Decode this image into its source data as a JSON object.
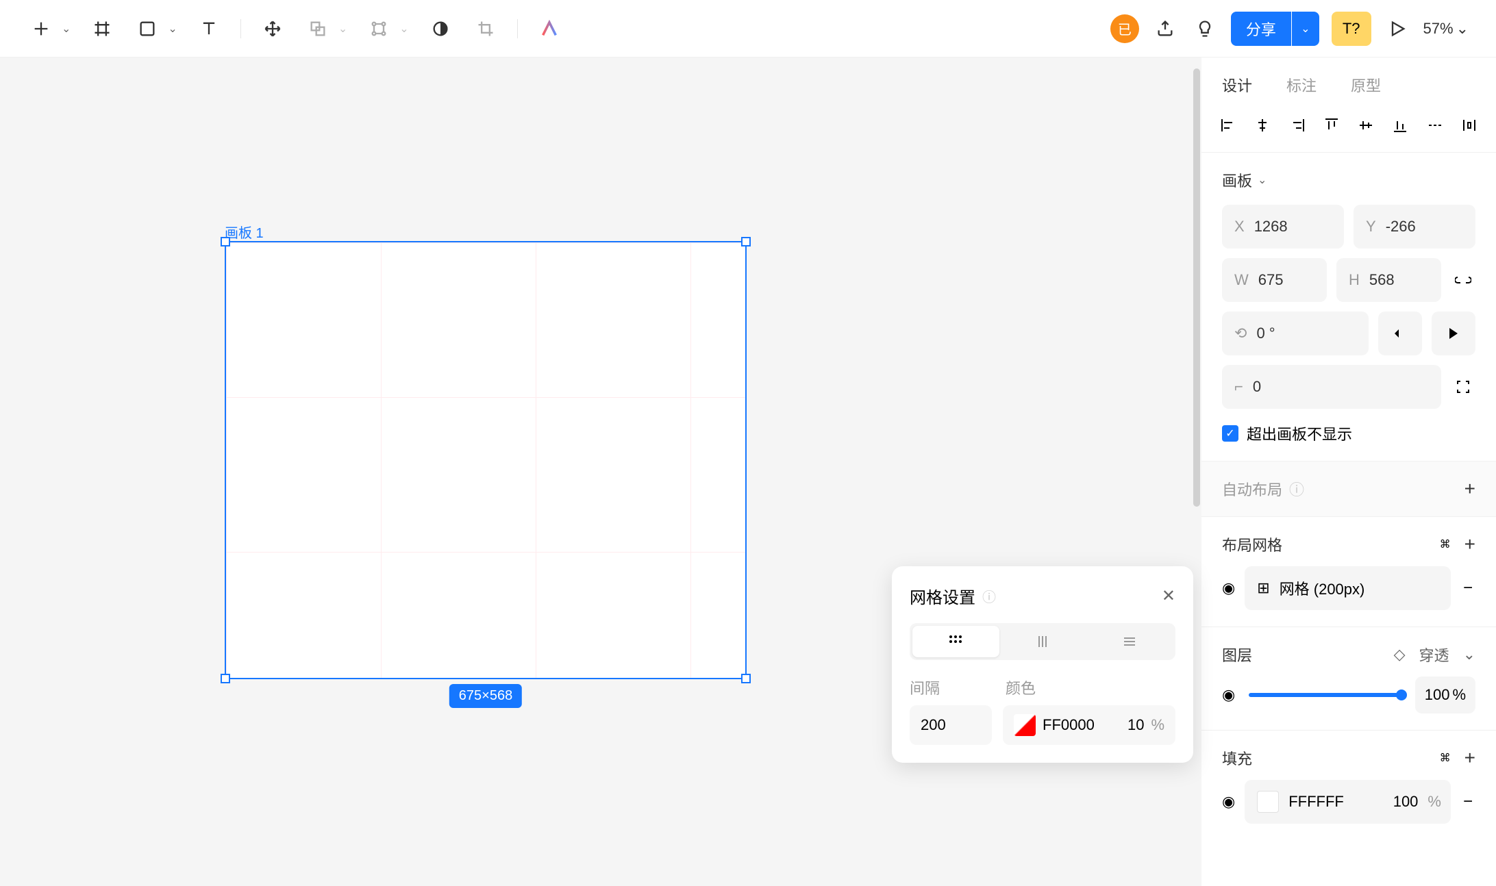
{
  "toolbar": {
    "share_label": "分享",
    "tq_label": "T?",
    "zoom": "57%",
    "saved_badge": "已"
  },
  "canvas": {
    "artboard_name": "画板 1",
    "dimensions": "675×568"
  },
  "tabs": {
    "design": "设计",
    "annotate": "标注",
    "prototype": "原型"
  },
  "artboard_section": {
    "title": "画板",
    "x_label": "X",
    "x_value": "1268",
    "y_label": "Y",
    "y_value": "-266",
    "w_label": "W",
    "w_value": "675",
    "h_label": "H",
    "h_value": "568",
    "rotation_value": "0 °",
    "corner_value": "0",
    "clip_label": "超出画板不显示"
  },
  "auto_layout": {
    "label": "自动布局"
  },
  "layout_grid": {
    "title": "布局网格",
    "shortcut": "⌘",
    "item_label": "网格 (200px)"
  },
  "layer": {
    "title": "图层",
    "blend_label": "穿透",
    "opacity_value": "100",
    "opacity_unit": "%"
  },
  "fill": {
    "title": "填充",
    "shortcut": "⌘",
    "color_hex": "FFFFFF",
    "opacity": "100",
    "opacity_unit": "%"
  },
  "grid_popup": {
    "title": "网格设置",
    "spacing_label": "间隔",
    "color_label": "颜色",
    "spacing_value": "200",
    "color_hex": "FF0000",
    "color_opacity": "10",
    "opacity_unit": "%"
  }
}
